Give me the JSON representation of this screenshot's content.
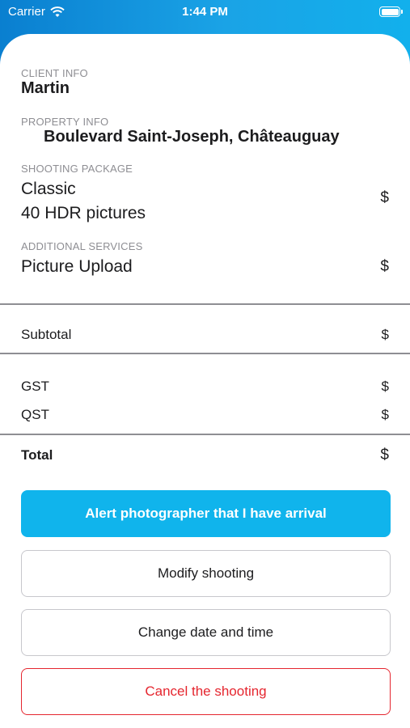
{
  "status_bar": {
    "carrier": "Carrier",
    "time": "1:44 PM"
  },
  "client": {
    "label": "CLIENT INFO",
    "name": "Martin"
  },
  "property": {
    "label": "PROPERTY INFO",
    "address": "Boulevard Saint-Joseph, Châteauguay"
  },
  "package": {
    "label": "SHOOTING PACKAGE",
    "name": "Classic",
    "detail": "40 HDR pictures",
    "price": "$"
  },
  "additional": {
    "label": "ADDITIONAL SERVICES",
    "service": "Picture Upload",
    "price": "$"
  },
  "totals": {
    "subtotal_label": "Subtotal",
    "subtotal_value": "$",
    "gst_label": "GST",
    "gst_value": "$",
    "qst_label": "QST",
    "qst_value": "$",
    "total_label": "Total",
    "total_value": "$"
  },
  "actions": {
    "alert_label": "Alert photographer that I have arrival",
    "modify_label": "Modify shooting",
    "change_label": "Change date and time",
    "cancel_label": "Cancel the shooting"
  },
  "colors": {
    "primary": "#10b4ec",
    "danger": "#e5262f",
    "header_gradient_start": "#0a7fd0"
  }
}
